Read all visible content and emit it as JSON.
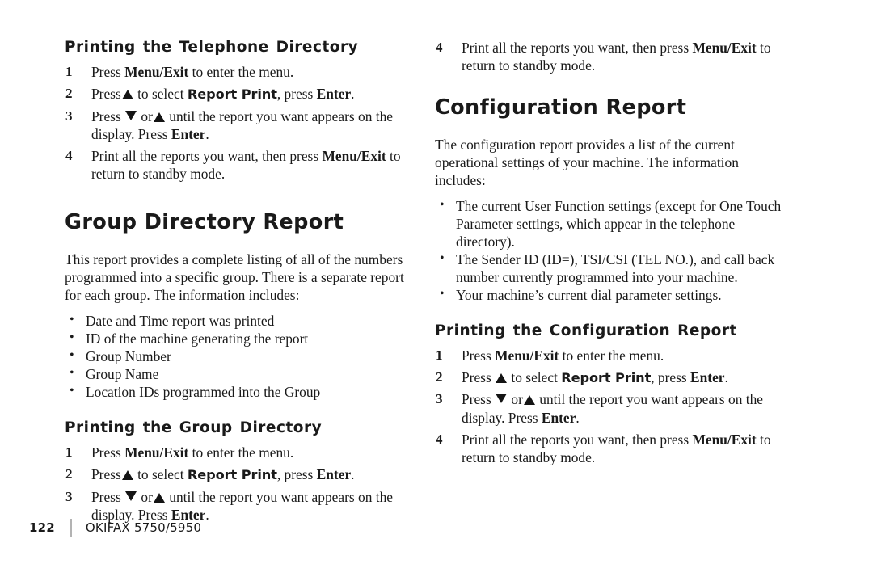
{
  "page": {
    "number": "122",
    "doc_name": "OKIFAX 5750/5950",
    "background": "#ffffff",
    "text_color": "#1a1a1a",
    "divider_color": "#b3b3b3"
  },
  "keys": {
    "menu_exit": "Menu/Exit",
    "enter": "Enter",
    "report_print": "Report Print",
    "up_arrow_icon": "triangle-up-icon",
    "down_arrow_icon": "triangle-down-icon"
  },
  "left_column": {
    "section_1": {
      "heading": "Printing the Telephone Directory",
      "steps": [
        {
          "num": "1",
          "parts": [
            {
              "t": "Press ",
              "s": "plain"
            },
            {
              "t": "Menu/Exit",
              "s": "bold-serif"
            },
            {
              "t": " to enter the menu.",
              "s": "plain"
            }
          ]
        },
        {
          "num": "2",
          "parts": [
            {
              "t": "Press",
              "s": "plain"
            },
            {
              "t": "",
              "s": "tri-up"
            },
            {
              "t": " to select ",
              "s": "plain"
            },
            {
              "t": "Report Print",
              "s": "bold-sans"
            },
            {
              "t": ", press ",
              "s": "plain"
            },
            {
              "t": "Enter",
              "s": "bold-serif"
            },
            {
              "t": ".",
              "s": "plain"
            }
          ]
        },
        {
          "num": "3",
          "parts": [
            {
              "t": "Press ",
              "s": "plain"
            },
            {
              "t": "",
              "s": "tri-down"
            },
            {
              "t": " or",
              "s": "plain"
            },
            {
              "t": "",
              "s": "tri-up"
            },
            {
              "t": " until the report you want appears on the display.  Press ",
              "s": "plain"
            },
            {
              "t": "Enter",
              "s": "bold-serif"
            },
            {
              "t": ".",
              "s": "plain"
            }
          ]
        },
        {
          "num": "4",
          "parts": [
            {
              "t": "Print all the reports you want, then press ",
              "s": "plain"
            },
            {
              "t": "Menu/Exit",
              "s": "bold-serif"
            },
            {
              "t": " to return to standby mode.",
              "s": "plain"
            }
          ]
        }
      ]
    },
    "section_2": {
      "heading": "Group Directory Report",
      "intro": "This report provides a complete listing of all of the numbers programmed into a specific group.  There is a separate report for each group. The information includes:",
      "bullets": [
        "Date and Time report was printed",
        "ID of the machine generating the report",
        "Group Number",
        "Group Name",
        "Location IDs programmed into the Group"
      ]
    },
    "section_3": {
      "heading": "Printing the Group Directory",
      "steps": [
        {
          "num": "1",
          "parts": [
            {
              "t": "Press ",
              "s": "plain"
            },
            {
              "t": "Menu/Exit",
              "s": "bold-serif"
            },
            {
              "t": " to enter the menu.",
              "s": "plain"
            }
          ]
        },
        {
          "num": "2",
          "parts": [
            {
              "t": "Press",
              "s": "plain"
            },
            {
              "t": "",
              "s": "tri-up"
            },
            {
              "t": " to select ",
              "s": "plain"
            },
            {
              "t": "Report Print",
              "s": "bold-sans"
            },
            {
              "t": ", press ",
              "s": "plain"
            },
            {
              "t": "Enter",
              "s": "bold-serif"
            },
            {
              "t": ".",
              "s": "plain"
            }
          ]
        },
        {
          "num": "3",
          "parts": [
            {
              "t": "Press ",
              "s": "plain"
            },
            {
              "t": "",
              "s": "tri-down"
            },
            {
              "t": " or",
              "s": "plain"
            },
            {
              "t": "",
              "s": "tri-up"
            },
            {
              "t": " until the report you want appears on the display.  Press ",
              "s": "plain"
            },
            {
              "t": "Enter",
              "s": "bold-serif"
            },
            {
              "t": ".",
              "s": "plain"
            }
          ]
        }
      ]
    }
  },
  "right_column": {
    "continued_step": {
      "num": "4",
      "parts": [
        {
          "t": "Print all the reports you want, then press ",
          "s": "plain"
        },
        {
          "t": "Menu/Exit",
          "s": "bold-serif"
        },
        {
          "t": " to return to standby mode.",
          "s": "plain"
        }
      ]
    },
    "section_1": {
      "heading": "Configuration Report",
      "intro": "The configuration report provides a list of the current operational settings of your machine. The information includes:",
      "bullets": [
        "The current User Function settings (except for One Touch Parameter settings, which appear in the telephone directory).",
        "The Sender ID (ID=), TSI/CSI (TEL NO.), and call back number currently programmed into your machine.",
        "Your machine’s current dial parameter settings."
      ]
    },
    "section_2": {
      "heading": "Printing the Configuration Report",
      "steps": [
        {
          "num": "1",
          "parts": [
            {
              "t": "Press ",
              "s": "plain"
            },
            {
              "t": "Menu/Exit",
              "s": "bold-serif"
            },
            {
              "t": " to enter the menu.",
              "s": "plain"
            }
          ]
        },
        {
          "num": "2",
          "parts": [
            {
              "t": "Press ",
              "s": "plain"
            },
            {
              "t": "",
              "s": "tri-up"
            },
            {
              "t": " to select ",
              "s": "plain"
            },
            {
              "t": "Report Print",
              "s": "bold-sans"
            },
            {
              "t": ", press ",
              "s": "plain"
            },
            {
              "t": "Enter",
              "s": "bold-serif"
            },
            {
              "t": ".",
              "s": "plain"
            }
          ]
        },
        {
          "num": "3",
          "parts": [
            {
              "t": "Press ",
              "s": "plain"
            },
            {
              "t": "",
              "s": "tri-down"
            },
            {
              "t": " or",
              "s": "plain"
            },
            {
              "t": "",
              "s": "tri-up"
            },
            {
              "t": " until the report you want appears on the display.  Press ",
              "s": "plain"
            },
            {
              "t": "Enter",
              "s": "bold-serif"
            },
            {
              "t": ".",
              "s": "plain"
            }
          ]
        },
        {
          "num": "4",
          "parts": [
            {
              "t": "Print all the reports you want, then press ",
              "s": "plain"
            },
            {
              "t": "Menu/Exit",
              "s": "bold-serif"
            },
            {
              "t": " to return to standby mode.",
              "s": "plain"
            }
          ]
        }
      ]
    }
  }
}
